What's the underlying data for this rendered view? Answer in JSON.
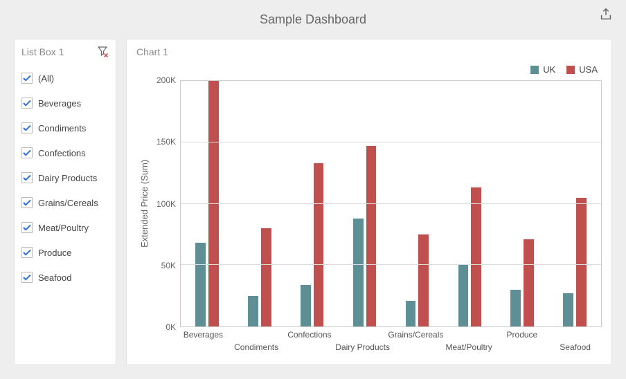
{
  "header": {
    "title": "Sample Dashboard"
  },
  "listbox": {
    "title": "List Box 1",
    "items": [
      {
        "label": "(All)",
        "checked": true
      },
      {
        "label": "Beverages",
        "checked": true
      },
      {
        "label": "Condiments",
        "checked": true
      },
      {
        "label": "Confections",
        "checked": true
      },
      {
        "label": "Dairy Products",
        "checked": true
      },
      {
        "label": "Grains/Cereals",
        "checked": true
      },
      {
        "label": "Meat/Poultry",
        "checked": true
      },
      {
        "label": "Produce",
        "checked": true
      },
      {
        "label": "Seafood",
        "checked": true
      }
    ]
  },
  "chart": {
    "title": "Chart 1",
    "legend": [
      {
        "name": "UK",
        "color": "#5d8f94"
      },
      {
        "name": "USA",
        "color": "#c0504e"
      }
    ],
    "ylabel": "Extended Price (Sum)",
    "yticks": [
      "0K",
      "50K",
      "100K",
      "150K",
      "200K"
    ]
  },
  "chart_data": {
    "type": "bar",
    "title": "Chart 1",
    "xlabel": "",
    "ylabel": "Extended Price (Sum)",
    "ylim": [
      0,
      200000
    ],
    "yticks": [
      0,
      50000,
      100000,
      150000,
      200000
    ],
    "categories": [
      "Beverages",
      "Condiments",
      "Confections",
      "Dairy Products",
      "Grains/Cereals",
      "Meat/Poultry",
      "Produce",
      "Seafood"
    ],
    "series": [
      {
        "name": "UK",
        "color": "#5d8f94",
        "values": [
          68000,
          25000,
          34000,
          88000,
          21000,
          50000,
          30000,
          27000
        ]
      },
      {
        "name": "USA",
        "color": "#c0504e",
        "values": [
          200000,
          80000,
          133000,
          147000,
          75000,
          113000,
          71000,
          105000
        ]
      }
    ],
    "legend_position": "top-right",
    "grid": true
  }
}
